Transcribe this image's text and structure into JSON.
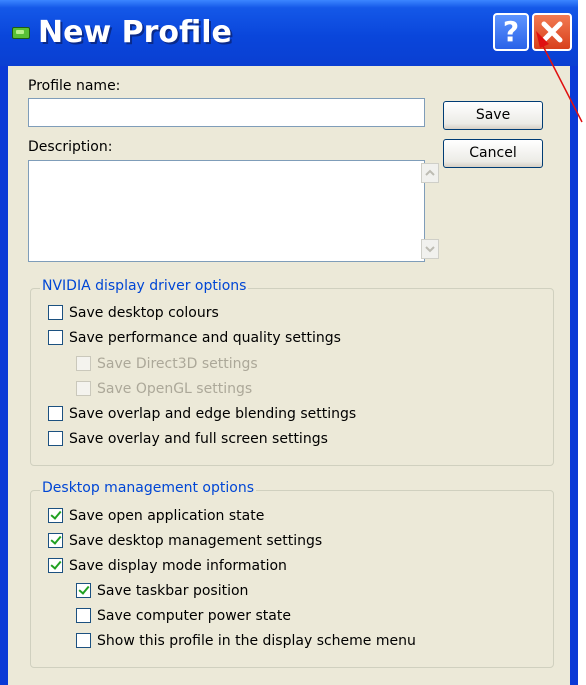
{
  "window": {
    "title": "New Profile",
    "help_glyph": "?",
    "close_icon": "close-x-icon"
  },
  "form": {
    "profile_name_label": "Profile name:",
    "profile_name_value": "",
    "description_label": "Description:",
    "description_value": ""
  },
  "buttons": {
    "save": "Save",
    "cancel": "Cancel"
  },
  "nvidia_group": {
    "title": "NVIDIA display driver options",
    "items": [
      {
        "label": "Save desktop colours",
        "checked": false,
        "enabled": true
      },
      {
        "label": "Save performance and quality settings",
        "checked": false,
        "enabled": true
      },
      {
        "label": "Save Direct3D settings",
        "checked": false,
        "enabled": false
      },
      {
        "label": "Save OpenGL settings",
        "checked": false,
        "enabled": false
      },
      {
        "label": "Save overlap and edge blending settings",
        "checked": false,
        "enabled": true
      },
      {
        "label": "Save overlay and full screen settings",
        "checked": false,
        "enabled": true
      }
    ]
  },
  "desktop_group": {
    "title": "Desktop management options",
    "items": [
      {
        "label": "Save open application state",
        "checked": true,
        "enabled": true
      },
      {
        "label": "Save desktop management settings",
        "checked": true,
        "enabled": true
      },
      {
        "label": "Save display mode information",
        "checked": true,
        "enabled": true
      },
      {
        "label": "Save taskbar position",
        "checked": true,
        "enabled": true
      },
      {
        "label": "Save computer power state",
        "checked": false,
        "enabled": true
      },
      {
        "label": "Show this profile in the display scheme menu",
        "checked": false,
        "enabled": true
      }
    ]
  },
  "colors": {
    "title_bar": "#0a46db",
    "dialog_bg": "#ece9d8",
    "group_title": "#0046d5",
    "annotation_arrow": "#e01010"
  }
}
